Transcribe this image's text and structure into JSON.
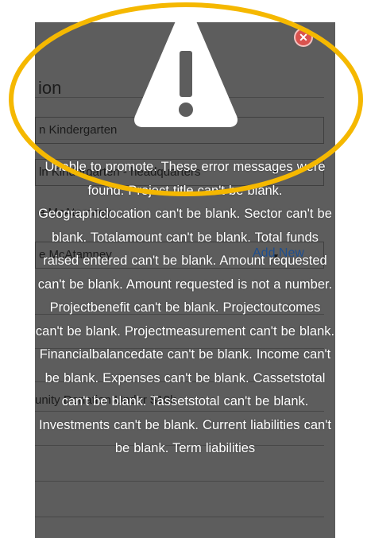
{
  "background_form": {
    "heading": "ion",
    "rows": [
      {
        "text": "n Kindergarten"
      },
      {
        "text": "ln Kindergarten - headquarters"
      },
      {
        "text": "e McAtamney"
      },
      {
        "text": "e McAtamney"
      }
    ],
    "add_new_label": "Add New",
    "lower_text": "unity Donation Under $10k"
  },
  "dialog": {
    "close_icon": "close-icon",
    "warning_icon": "warning-triangle-icon",
    "message": "Unable to promote. These error messages were found: Project title can't be blank. Geographiclocation can't be blank. Sector can't be blank. Totalamount can't be blank. Total funds raised entered can't be blank. Amount requested can't be blank. Amount requested is not a number. Projectbenefit can't be blank. Projectoutcomes can't be blank. Projectmeasurement can't be blank. Financialbalancedate can't be blank. Income can't be blank. Expenses can't be blank. Cassetstotal can't be blank. Tassetstotal can't be blank. Investments can't be blank. Current liabilities can't be blank. Term liabilities"
  },
  "colors": {
    "overlay": "#5d5d5d",
    "highlight": "#f5b800",
    "close": "#d9534f",
    "text": "#ffffff"
  }
}
